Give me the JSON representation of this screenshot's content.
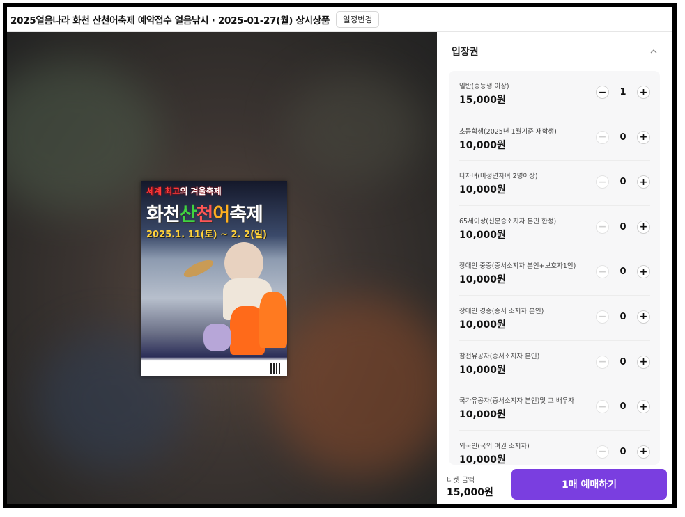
{
  "header": {
    "title": "2025얼음나라 화천 산천어축제 예약접수 얼음낚시 · 2025-01-27(월) 상시상품",
    "change_schedule_label": "일정변경"
  },
  "poster": {
    "line1_prefix": "세계 최고",
    "line1_suffix": "의 겨울축제",
    "line2_a": "화천",
    "line2_b": "산",
    "line2_c": "천",
    "line2_d": "어",
    "line2_e": "축제",
    "line3": "2025.1. 11(토) ~ 2. 2(일)"
  },
  "tickets": {
    "section_title": "입장권",
    "items": [
      {
        "label": "일반(중등생 이상)",
        "price": "15,000원",
        "qty": "1"
      },
      {
        "label": "초등학생(2025년 1월기준 재학생)",
        "price": "10,000원",
        "qty": "0"
      },
      {
        "label": "다자녀(미성년자녀 2명이상)",
        "price": "10,000원",
        "qty": "0"
      },
      {
        "label": "65세이상(신분증소지자 본인 한정)",
        "price": "10,000원",
        "qty": "0"
      },
      {
        "label": "장애인 중증(증서소지자 본인+보호자1인)",
        "price": "10,000원",
        "qty": "0"
      },
      {
        "label": "장애인 경증(증서 소지자 본인)",
        "price": "10,000원",
        "qty": "0"
      },
      {
        "label": "참전유공자(증서소지자 본인)",
        "price": "10,000원",
        "qty": "0"
      },
      {
        "label": "국가유공자(증서소지자 본인)및 그 배우자",
        "price": "10,000원",
        "qty": "0"
      },
      {
        "label": "외국인(국외 여권 소지자)",
        "price": "10,000원",
        "qty": "0"
      }
    ],
    "minus_symbol": "−",
    "plus_symbol": "+"
  },
  "footer": {
    "total_label": "티켓 금액",
    "total_value": "15,000원",
    "buy_label": "1매 예매하기"
  },
  "colors": {
    "accent": "#7a3ee0",
    "background_blur": "#3b3431"
  }
}
